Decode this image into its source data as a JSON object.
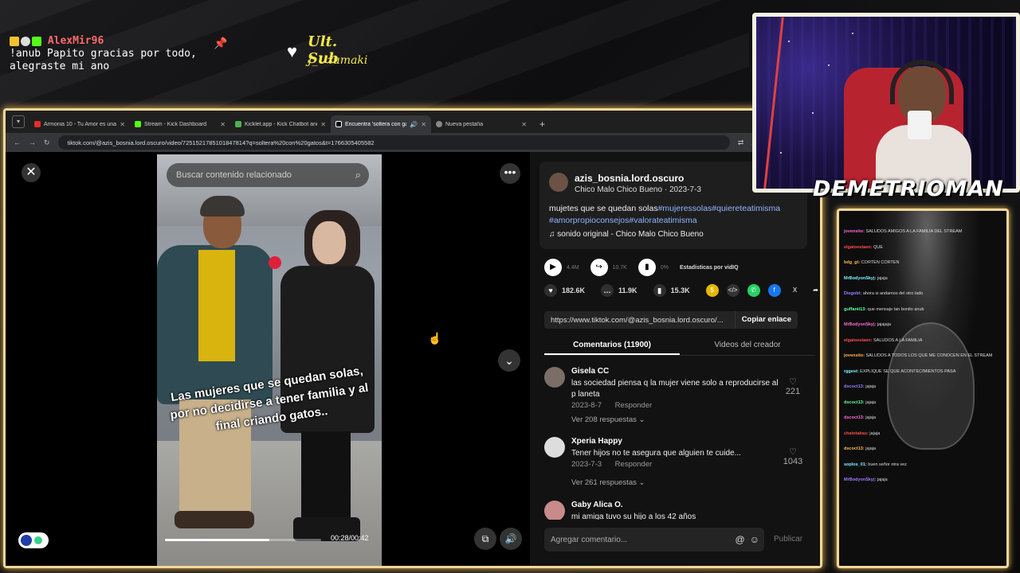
{
  "overlay": {
    "chat_user": "AlexMir96",
    "chat_message_line1": "!anub Papito gracias por todo,",
    "chat_message_line2": "alegraste mi ano",
    "sub_label": "Ult. Sub",
    "sub_name": "J_Uzumaki",
    "streamer_name": "DEMETRIOMAN"
  },
  "browser": {
    "tabs": [
      {
        "title": "Armonia 10 - Tu Amor es una",
        "favicon_color": "#e52d27",
        "active": false
      },
      {
        "title": "Stream - Kick Dashboard",
        "favicon_color": "#53fc18",
        "active": false
      },
      {
        "title": "Kicklet.app - Kick Chatbot and",
        "favicon_color": "#4caf50",
        "active": false
      },
      {
        "title": "Encuentra 'soltera con gat",
        "favicon_color": "#000000",
        "active": true
      },
      {
        "title": "Nueva pestaña",
        "favicon_color": "#888888",
        "active": false
      }
    ],
    "url": "tiktok.com/@azis_bosnia.lord.oscuro/video/7251521785101847814?q=soltera%20con%20gatos&t=1766305405582"
  },
  "video": {
    "search_placeholder": "Buscar contenido relacionado",
    "caption": "Las mujeres que se quedan solas, por no decidirse a tener familia y al final criando gatos..",
    "time_current": "00:28",
    "time_total": "00:42",
    "timecode": "00:28/00:42",
    "progress": 0.67
  },
  "post": {
    "author": "azis_bosnia.lord.oscuro",
    "meta": "Chico Malo Chico Bueno · 2023-7-3",
    "desc_plain": "mujetes que se quedan solas",
    "desc_tags_line1": "#mujeressolas#quiereteatimisma",
    "desc_tags_line2": "#amorpropioconsejos#valorateatimisma",
    "sound": "sonido original - Chico Malo Chico Bueno",
    "ext_views": "4.4M",
    "ext_shares": "10.7K",
    "ext_pct": "0%",
    "ext_label": "Estadísticas por vidIQ",
    "likes": "182.6K",
    "comments": "11.9K",
    "saves": "15.3K",
    "link": "https://www.tiktok.com/@azis_bosnia.lord.oscuro/...",
    "copy_label": "Copiar enlace",
    "tab_comments": "Comentarios (11900)",
    "tab_creator": "Videos del creador",
    "comment_placeholder": "Agregar comentario...",
    "publish_label": "Publicar"
  },
  "comments": [
    {
      "user": "Gisela CC",
      "text": "las sociedad piensa q la mujer viene solo a reproducirse al p laneta",
      "date": "2023-8-7",
      "reply": "Responder",
      "likes": "221",
      "replies": "Ver 208 respuestas"
    },
    {
      "user": "Xperia Happy",
      "text": "Tener hijos no te asegura que alguien te cuide...",
      "date": "2023-7-3",
      "reply": "Responder",
      "likes": "1043",
      "replies": "Ver 261 respuestas"
    },
    {
      "user": "Gaby Alica O.",
      "text": "mi amiga tuvo su hijo a los 42 años"
    }
  ],
  "side_chat": [
    {
      "user": "jovensito",
      "msg": "SALUDOS AMIGOS A LA FAMILIA DEL STREAM"
    },
    {
      "user": "elgatoestaen",
      "msg": "QUE"
    },
    {
      "user": "bdg_gt",
      "msg": "CORTEN CORTEN"
    },
    {
      "user": "MrBodyonSkyj",
      "msg": "jajaja"
    },
    {
      "user": "Diegobt",
      "msg": "ahora si andamos del otro lado"
    },
    {
      "user": "guffanti13",
      "msg": "que mensaje tan bonito anub"
    },
    {
      "user": "MrBodyonSkyj",
      "msg": "jajajaja"
    },
    {
      "user": "elgatoestaen",
      "msg": "SALUDOS A LA FAMILIA"
    },
    {
      "user": "jovensito",
      "msg": "SALUDOS A TODOS LOS QUE ME CONOCEN EN EL STREAM"
    },
    {
      "user": "rggest",
      "msg": "EXPLIQUE SE QUE ACONTECIMIENTOS PASA"
    },
    {
      "user": "dscoct13",
      "msg": "jajaja"
    },
    {
      "user": "dscoct13",
      "msg": "jajaja"
    },
    {
      "user": "dscoct13",
      "msg": "jajaja"
    },
    {
      "user": "chatotabas",
      "msg": "jajaja"
    },
    {
      "user": "dscoct13",
      "msg": "jajaja"
    },
    {
      "user": "soplos_01",
      "msg": "buen señor otra vez"
    },
    {
      "user": "MrBodyonSkyj",
      "msg": "jajaja"
    }
  ]
}
